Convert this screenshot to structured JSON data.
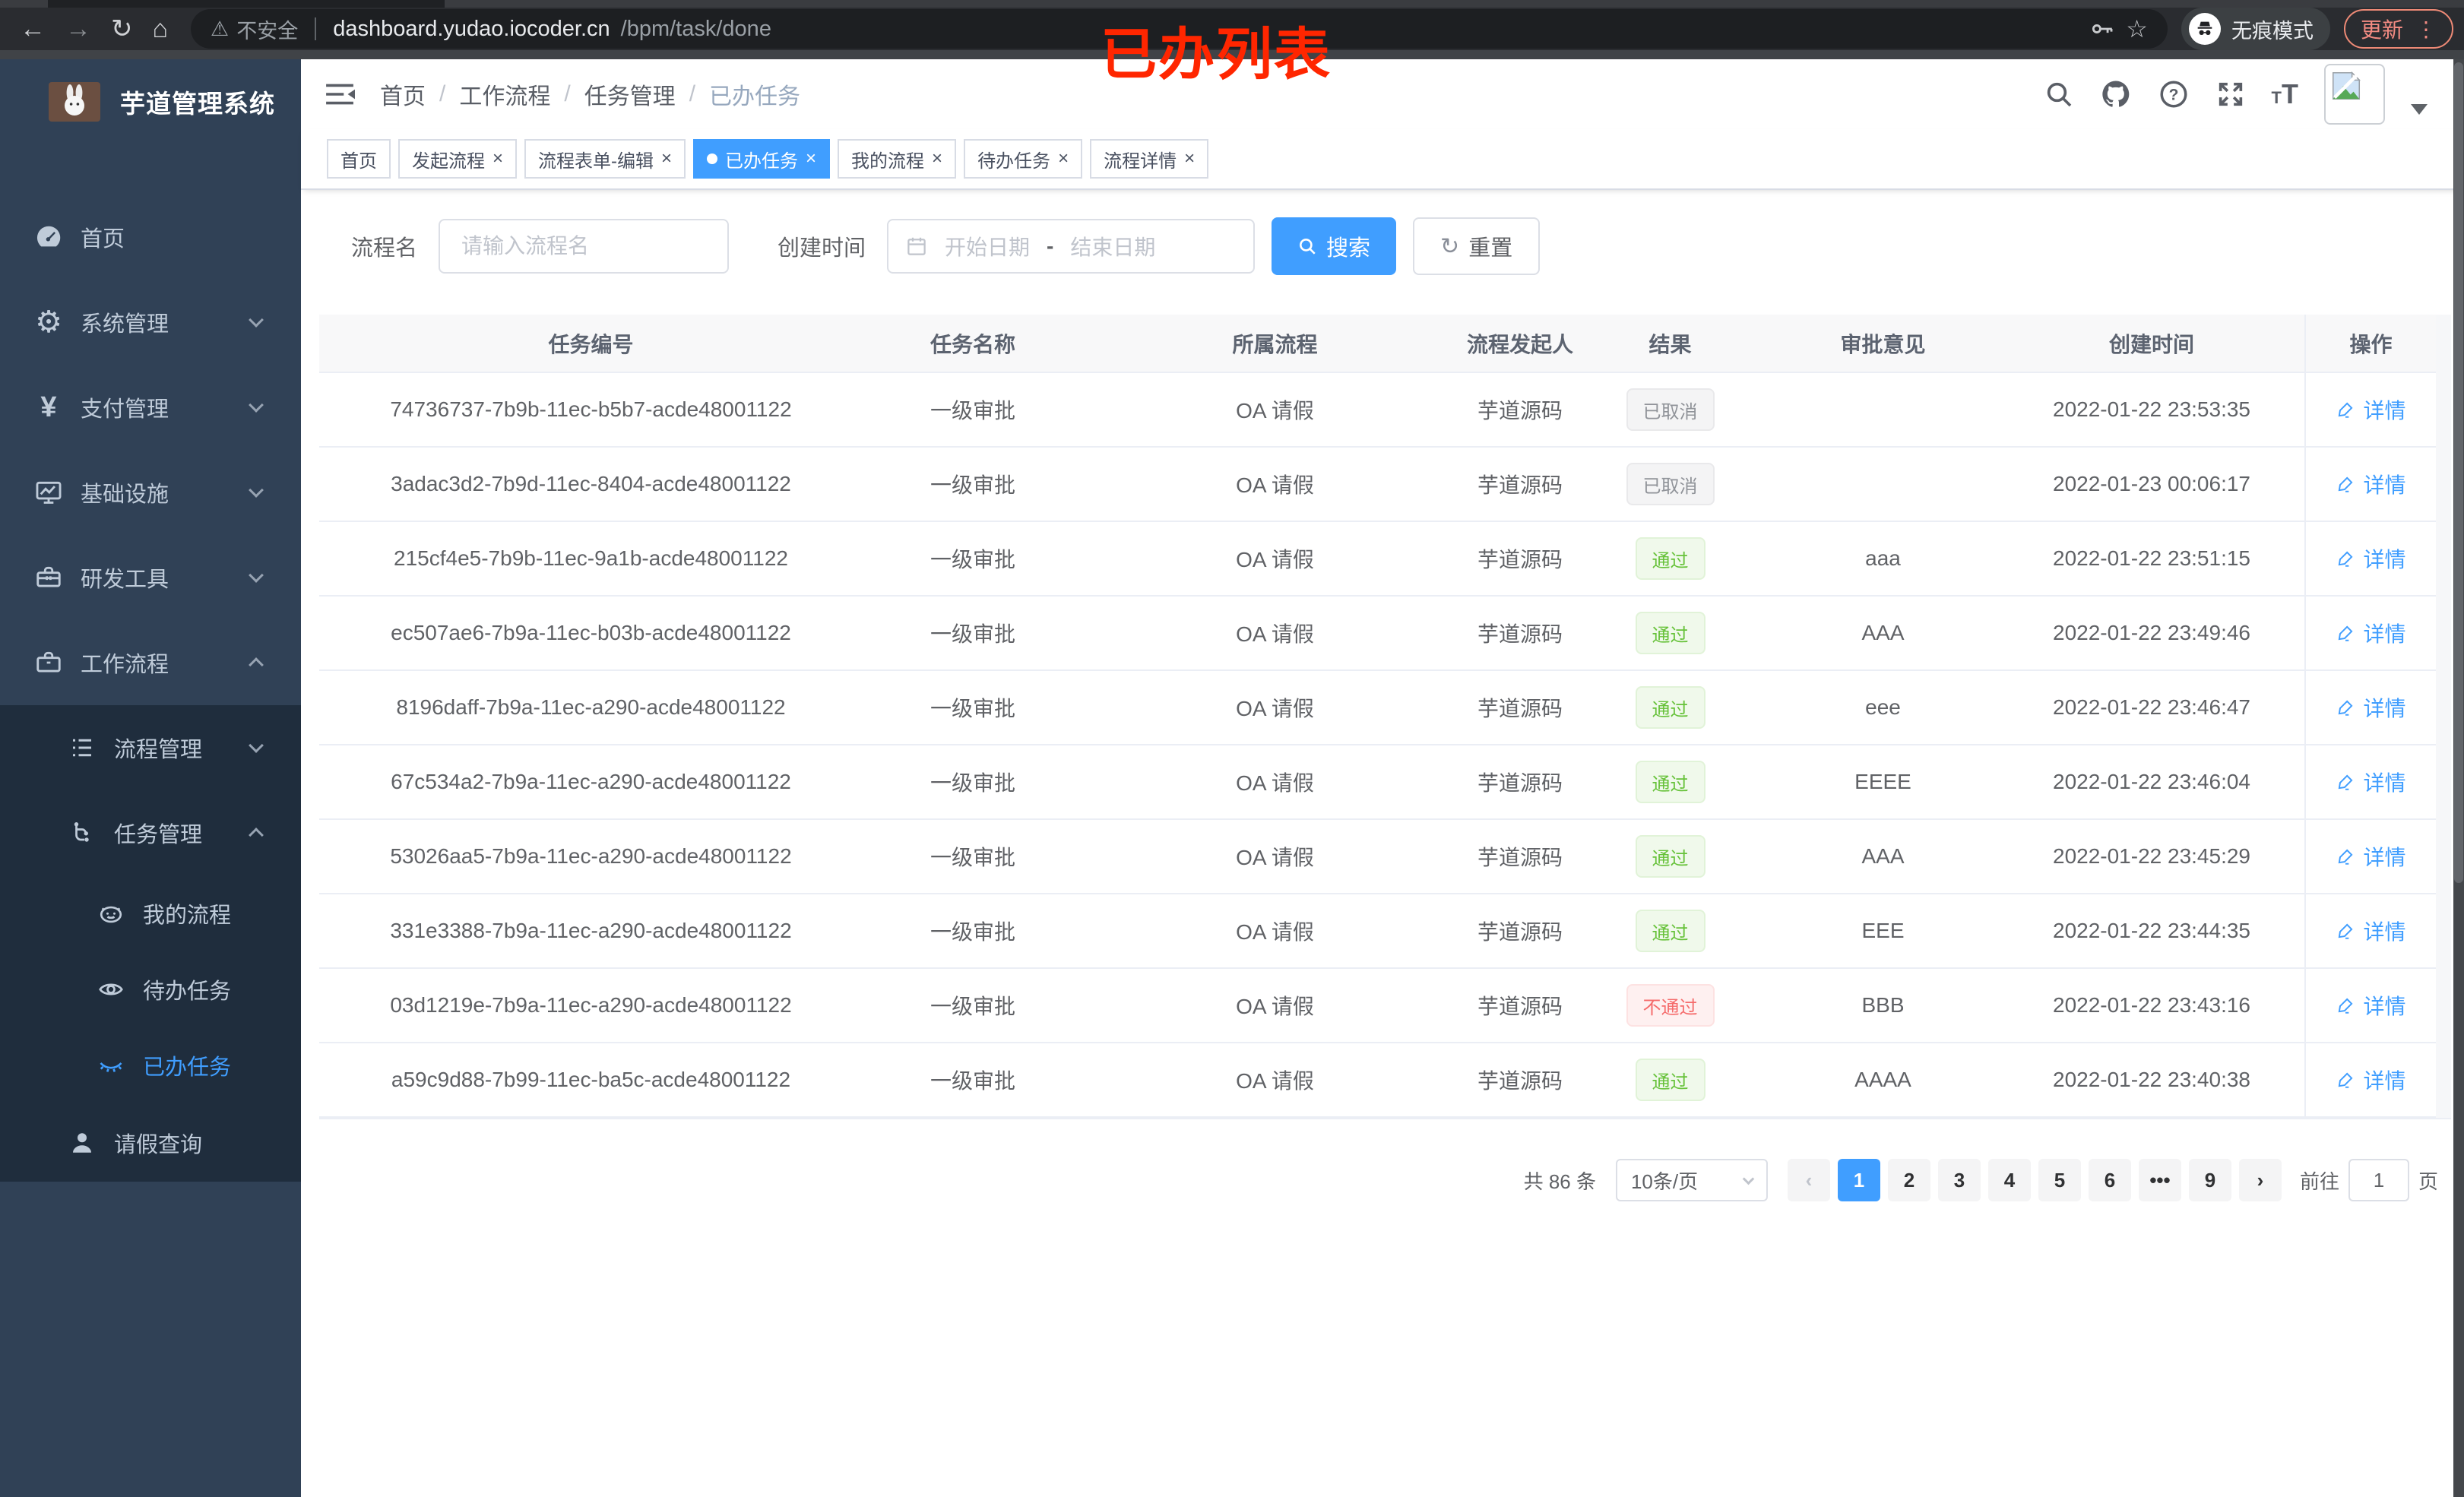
{
  "browser": {
    "security": "不安全",
    "url_host": "dashboard.yudao.iocoder.cn",
    "url_path": "/bpm/task/done",
    "incognito": "无痕模式",
    "update": "更新"
  },
  "annotation": "已办列表",
  "colors": {
    "accent": "#409eff",
    "success": "#67c23a",
    "danger": "#f56c6c",
    "info": "#909399",
    "sidebar_bg": "#304156",
    "submenu_bg": "#1f2d3d"
  },
  "sidebar": {
    "title": "芋道管理系统",
    "items": [
      {
        "label": "首页"
      },
      {
        "label": "系统管理"
      },
      {
        "label": "支付管理"
      },
      {
        "label": "基础设施"
      },
      {
        "label": "研发工具"
      },
      {
        "label": "工作流程"
      },
      {
        "label": "流程管理"
      },
      {
        "label": "任务管理"
      },
      {
        "label": "我的流程"
      },
      {
        "label": "待办任务"
      },
      {
        "label": "已办任务"
      },
      {
        "label": "请假查询"
      }
    ]
  },
  "breadcrumb": [
    "首页",
    "工作流程",
    "任务管理",
    "已办任务"
  ],
  "tabs": [
    {
      "label": "首页",
      "state": "plain",
      "closable": "no"
    },
    {
      "label": "发起流程",
      "state": "plain",
      "closable": "yes"
    },
    {
      "label": "流程表单-编辑",
      "state": "plain",
      "closable": "yes"
    },
    {
      "label": "已办任务",
      "state": "active",
      "closable": "yes"
    },
    {
      "label": "我的流程",
      "state": "plain",
      "closable": "yes"
    },
    {
      "label": "待办任务",
      "state": "plain",
      "closable": "yes"
    },
    {
      "label": "流程详情",
      "state": "plain",
      "closable": "yes"
    }
  ],
  "filters": {
    "name_label": "流程名",
    "name_placeholder": "请输入流程名",
    "time_label": "创建时间",
    "start_placeholder": "开始日期",
    "range_separator": "-",
    "end_placeholder": "结束日期",
    "search_label": "搜索",
    "reset_label": "重置"
  },
  "table": {
    "columns": [
      "任务编号",
      "任务名称",
      "所属流程",
      "流程发起人",
      "结果",
      "审批意见",
      "创建时间",
      "操作"
    ],
    "rows": [
      {
        "id": "74736737-7b9b-11ec-b5b7-acde48001122",
        "name": "一级审批",
        "process": "OA 请假",
        "starter": "芋道源码",
        "result": "已取消",
        "result_type": "info",
        "opinion": "",
        "time": "2022-01-22 23:53:35",
        "action": "详情"
      },
      {
        "id": "3adac3d2-7b9d-11ec-8404-acde48001122",
        "name": "一级审批",
        "process": "OA 请假",
        "starter": "芋道源码",
        "result": "已取消",
        "result_type": "info",
        "opinion": "",
        "time": "2022-01-23 00:06:17",
        "action": "详情"
      },
      {
        "id": "215cf4e5-7b9b-11ec-9a1b-acde48001122",
        "name": "一级审批",
        "process": "OA 请假",
        "starter": "芋道源码",
        "result": "通过",
        "result_type": "success",
        "opinion": "aaa",
        "time": "2022-01-22 23:51:15",
        "action": "详情"
      },
      {
        "id": "ec507ae6-7b9a-11ec-b03b-acde48001122",
        "name": "一级审批",
        "process": "OA 请假",
        "starter": "芋道源码",
        "result": "通过",
        "result_type": "success",
        "opinion": "AAA",
        "time": "2022-01-22 23:49:46",
        "action": "详情"
      },
      {
        "id": "8196daff-7b9a-11ec-a290-acde48001122",
        "name": "一级审批",
        "process": "OA 请假",
        "starter": "芋道源码",
        "result": "通过",
        "result_type": "success",
        "opinion": "eee",
        "time": "2022-01-22 23:46:47",
        "action": "详情"
      },
      {
        "id": "67c534a2-7b9a-11ec-a290-acde48001122",
        "name": "一级审批",
        "process": "OA 请假",
        "starter": "芋道源码",
        "result": "通过",
        "result_type": "success",
        "opinion": "EEEE",
        "time": "2022-01-22 23:46:04",
        "action": "详情"
      },
      {
        "id": "53026aa5-7b9a-11ec-a290-acde48001122",
        "name": "一级审批",
        "process": "OA 请假",
        "starter": "芋道源码",
        "result": "通过",
        "result_type": "success",
        "opinion": "AAA",
        "time": "2022-01-22 23:45:29",
        "action": "详情"
      },
      {
        "id": "331e3388-7b9a-11ec-a290-acde48001122",
        "name": "一级审批",
        "process": "OA 请假",
        "starter": "芋道源码",
        "result": "通过",
        "result_type": "success",
        "opinion": "EEE",
        "time": "2022-01-22 23:44:35",
        "action": "详情"
      },
      {
        "id": "03d1219e-7b9a-11ec-a290-acde48001122",
        "name": "一级审批",
        "process": "OA 请假",
        "starter": "芋道源码",
        "result": "不通过",
        "result_type": "danger",
        "opinion": "BBB",
        "time": "2022-01-22 23:43:16",
        "action": "详情"
      },
      {
        "id": "a59c9d88-7b99-11ec-ba5c-acde48001122",
        "name": "一级审批",
        "process": "OA 请假",
        "starter": "芋道源码",
        "result": "通过",
        "result_type": "success",
        "opinion": "AAAA",
        "time": "2022-01-22 23:40:38",
        "action": "详情"
      }
    ]
  },
  "pagination": {
    "total": "共 86 条",
    "page_size": "10条/页",
    "prev": "‹",
    "next": "›",
    "pages": [
      {
        "label": "1",
        "state": "active"
      },
      {
        "label": "2",
        "state": "page"
      },
      {
        "label": "3",
        "state": "page"
      },
      {
        "label": "4",
        "state": "page"
      },
      {
        "label": "5",
        "state": "page"
      },
      {
        "label": "6",
        "state": "page"
      },
      {
        "label": "•••",
        "state": "page"
      },
      {
        "label": "9",
        "state": "page"
      }
    ],
    "jump_prefix": "前往",
    "jump_value": "1",
    "jump_suffix": "页"
  }
}
